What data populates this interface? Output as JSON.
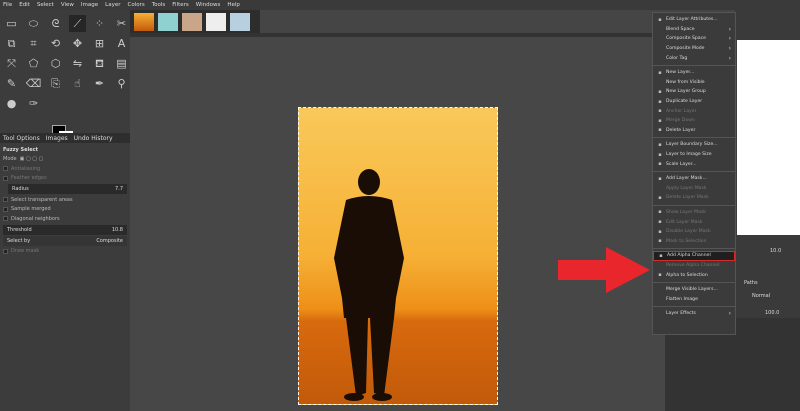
{
  "menubar": [
    "File",
    "Edit",
    "Select",
    "View",
    "Image",
    "Layer",
    "Colors",
    "Tools",
    "Filters",
    "Windows",
    "Help"
  ],
  "tabs": {
    "tool_options": "Tool Options",
    "images": "Images",
    "undo": "Undo History"
  },
  "tool_options": {
    "title": "Fuzzy Select",
    "mode_label": "Mode",
    "antialiasing": "Antialiasing",
    "feather": "Feather edges",
    "radius_label": "Radius",
    "radius_value": "7.7",
    "transparent": "Select transparent areas",
    "sample_merged": "Sample merged",
    "diagonal": "Diagonal neighbors",
    "threshold_label": "Threshold",
    "threshold_value": "10.8",
    "select_by_label": "Select by",
    "select_by_value": "Composite",
    "draw_mask": "Draw mask"
  },
  "right": {
    "opacity_value": "10.0",
    "paths_tab": "Paths",
    "mode_value": "Normal",
    "layer_opacity": "100.0"
  },
  "menu": [
    {
      "label": "Edit Layer Attributes...",
      "icon": "edit-icon"
    },
    {
      "label": "Blend Space",
      "sub": true
    },
    {
      "label": "Composite Space",
      "sub": true
    },
    {
      "label": "Composite Mode",
      "sub": true
    },
    {
      "label": "Color Tag",
      "sub": true
    },
    {
      "sep": true
    },
    {
      "label": "New Layer...",
      "icon": "new-layer-icon"
    },
    {
      "label": "New from Visible"
    },
    {
      "label": "New Layer Group",
      "icon": "folder-icon"
    },
    {
      "label": "Duplicate Layer",
      "icon": "duplicate-icon"
    },
    {
      "label": "Anchor Layer",
      "icon": "anchor-icon",
      "disabled": true
    },
    {
      "label": "Merge Down",
      "icon": "merge-icon",
      "disabled": true
    },
    {
      "label": "Delete Layer",
      "icon": "delete-icon"
    },
    {
      "sep": true
    },
    {
      "label": "Layer Boundary Size...",
      "icon": "boundary-icon"
    },
    {
      "label": "Layer to Image Size",
      "icon": "fit-icon"
    },
    {
      "label": "Scale Layer...",
      "icon": "scale-icon"
    },
    {
      "sep": true
    },
    {
      "label": "Add Layer Mask...",
      "icon": "mask-icon"
    },
    {
      "label": "Apply Layer Mask",
      "disabled": true
    },
    {
      "label": "Delete Layer Mask",
      "icon": "delete-icon",
      "disabled": true
    },
    {
      "sep": true
    },
    {
      "label": "Show Layer Mask",
      "icon": "checkbox-icon",
      "disabled": true
    },
    {
      "label": "Edit Layer Mask",
      "icon": "checkbox-icon",
      "disabled": true
    },
    {
      "label": "Disable Layer Mask",
      "icon": "checkbox-icon",
      "disabled": true
    },
    {
      "label": "Mask to Selection",
      "icon": "selection-icon",
      "disabled": true
    },
    {
      "sep": true
    },
    {
      "label": "Add Alpha Channel",
      "icon": "alpha-icon",
      "highlight": true
    },
    {
      "label": "Remove Alpha Channel",
      "disabled": true
    },
    {
      "label": "Alpha to Selection",
      "icon": "selection-icon"
    },
    {
      "sep": true
    },
    {
      "label": "Merge Visible Layers..."
    },
    {
      "label": "Flatten Image"
    },
    {
      "sep": true
    },
    {
      "label": "Layer Effects",
      "sub": true
    }
  ],
  "colors": {
    "highlight": "#d42a2a",
    "arrow": "#e8262b"
  }
}
